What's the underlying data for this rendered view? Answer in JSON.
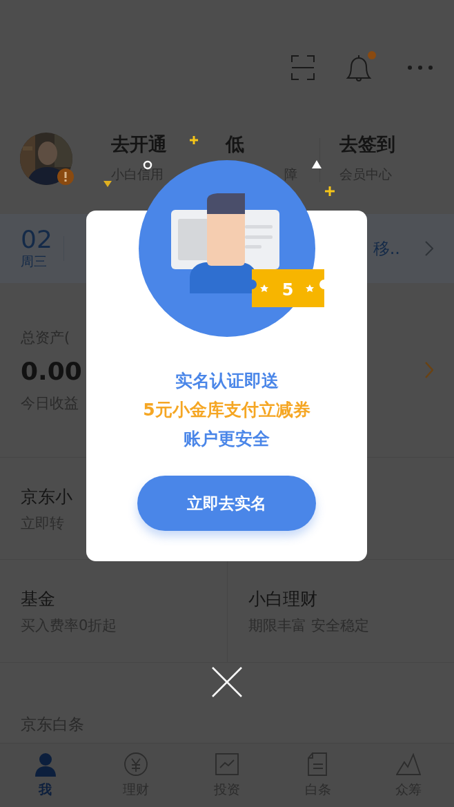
{
  "top_bar": {
    "has_notification": true
  },
  "profile": {
    "alert": true,
    "items": [
      {
        "title": "去开通",
        "subtitle": "小白信用"
      },
      {
        "title": "低",
        "subtitle": "障"
      },
      {
        "title": "去签到",
        "subtitle": "会员中心"
      }
    ]
  },
  "notice_bar": {
    "day": "02",
    "weekday": "周三",
    "text": "移.."
  },
  "assets": {
    "label": "总资产(",
    "amount": "0.00",
    "sub_label": "今日收益"
  },
  "products": [
    {
      "title": "京东小",
      "subtitle": "立即转"
    },
    {
      "title": "基金",
      "subtitle": "买入费率0折起"
    },
    {
      "title": "小白理财",
      "subtitle": "期限丰富 安全稳定"
    }
  ],
  "section": {
    "title": "京东白条"
  },
  "dialog": {
    "badge_value": "5",
    "lines": [
      {
        "text": "实名认证即送",
        "kind": "plain"
      },
      {
        "text": "5元小金库支付立减券",
        "kind": "highlight"
      },
      {
        "text": "账户更安全",
        "kind": "plain"
      }
    ],
    "button": "立即去实名"
  },
  "tabs": [
    {
      "label": "我",
      "selected": true,
      "kind": "person"
    },
    {
      "label": "理财",
      "selected": false,
      "kind": "coin"
    },
    {
      "label": "投资",
      "selected": false,
      "kind": "chart"
    },
    {
      "label": "白条",
      "selected": false,
      "kind": "document"
    },
    {
      "label": "众筹",
      "selected": false,
      "kind": "mountain"
    }
  ]
}
